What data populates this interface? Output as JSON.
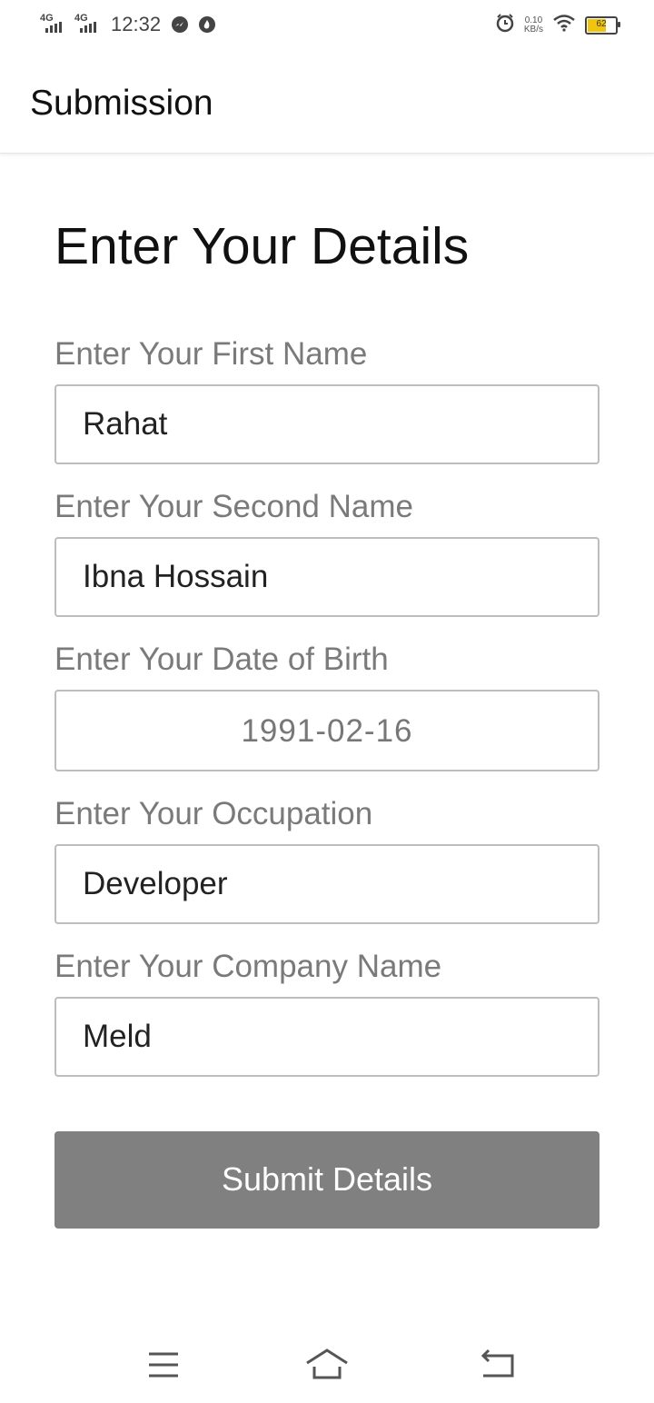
{
  "status_bar": {
    "time": "12:32",
    "network": [
      "4G",
      "4G"
    ],
    "speed_value": "0.10",
    "speed_unit": "KB/s",
    "battery_level": "62",
    "battery_fraction": 0.62,
    "icons": [
      "messenger-icon",
      "flame-icon",
      "alarm-icon",
      "wifi-icon",
      "battery-icon"
    ]
  },
  "app_bar": {
    "title": "Submission"
  },
  "form": {
    "title": "Enter Your Details",
    "fields": [
      {
        "label": "Enter Your First Name",
        "value": "Rahat"
      },
      {
        "label": "Enter Your Second Name",
        "value": "Ibna Hossain"
      },
      {
        "label": "Enter Your Date of Birth",
        "value": "1991-02-16"
      },
      {
        "label": "Enter Your Occupation",
        "value": "Developer"
      },
      {
        "label": "Enter Your Company Name",
        "value": "Meld"
      }
    ],
    "submit_label": "Submit Details"
  },
  "nav_bar": {
    "icons": [
      "menu-icon",
      "home-icon",
      "back-icon"
    ]
  },
  "colors": {
    "button": "#808080",
    "label": "#7a7a7a",
    "border": "#bdbdbd",
    "battery": "#f1c40f"
  }
}
